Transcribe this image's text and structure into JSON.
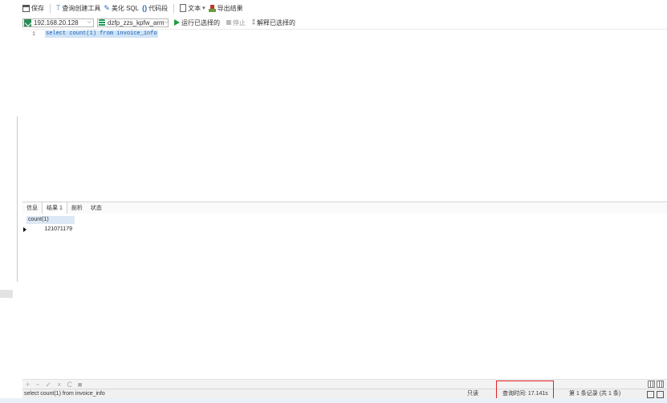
{
  "toolbar": {
    "save_label": "保存",
    "query_builder_label": "查询创建工具",
    "beautify_label": "美化 SQL",
    "code_snippet_label": "代码段",
    "text_label": "文本",
    "export_label": "导出结果"
  },
  "connection": {
    "server": "192.168.20.128",
    "database": "dzfp_zzs_kpfw_arm",
    "run_selected_label": "运行已选择的",
    "stop_label": "停止",
    "explain_selected_label": "解释已选择的"
  },
  "editor": {
    "line_number": "1",
    "sql": "select count(1) from invoice_info"
  },
  "result_tabs": {
    "items": [
      "信息",
      "结果 1",
      "剖析",
      "状态"
    ],
    "active_index": 1
  },
  "grid": {
    "columns": [
      "count(1)"
    ],
    "rows": [
      [
        "121071179"
      ]
    ]
  },
  "grid_toolbar": {
    "buttons": [
      "+",
      "−",
      "✓",
      "×",
      "C",
      "■"
    ]
  },
  "status": {
    "sql": "select count(1) from invoice_info",
    "mode": "只读",
    "query_time": "查询时间: 17.141s",
    "records": "第 1 条记录 (共 1 条)",
    "highlight_color": "#e02020"
  },
  "colors": {
    "selection": "#cfe3f7",
    "header_bg": "#dce8f5",
    "run_green": "#1e9e3e"
  }
}
